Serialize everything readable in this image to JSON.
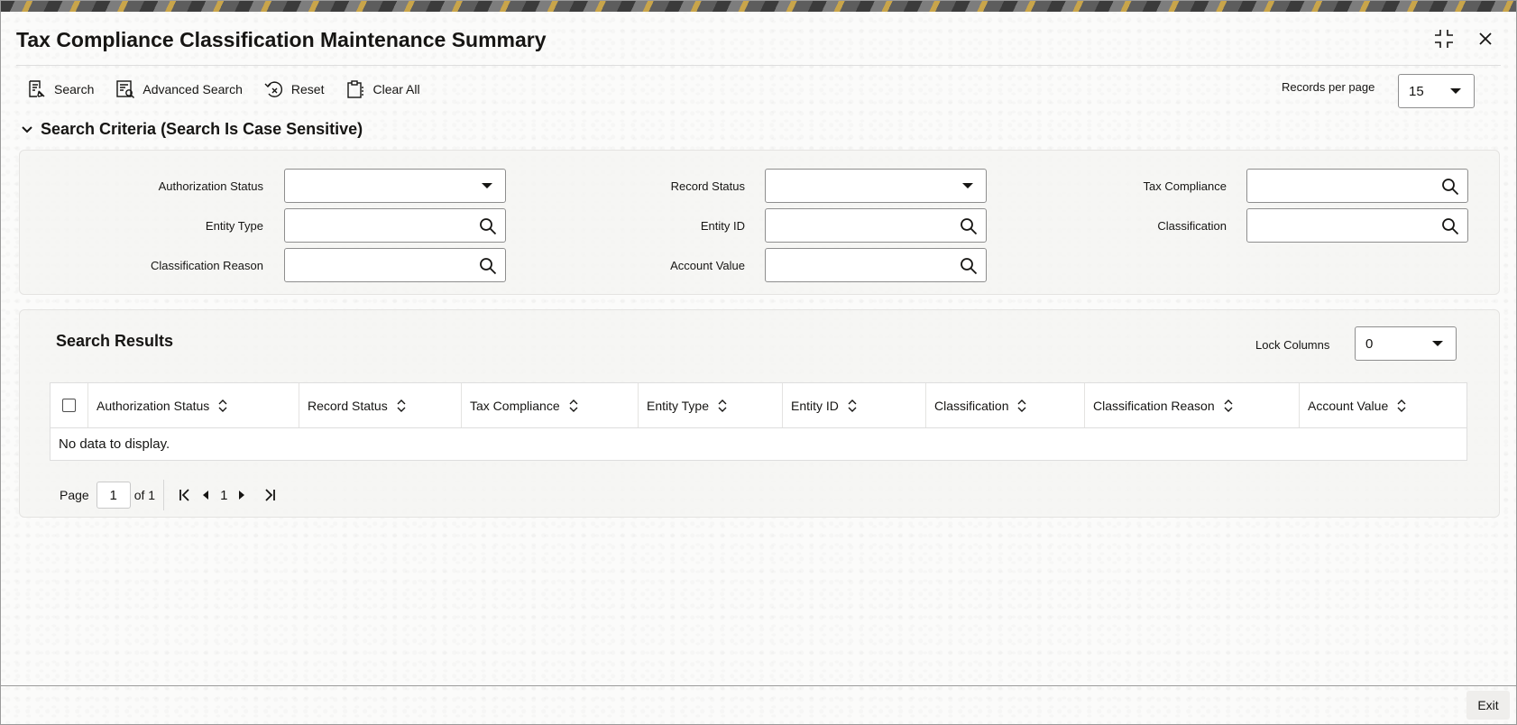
{
  "window": {
    "title": "Tax Compliance Classification Maintenance Summary"
  },
  "toolbar": {
    "search_label": "Search",
    "advanced_search_label": "Advanced Search",
    "reset_label": "Reset",
    "clear_all_label": "Clear All",
    "records_per_page_label": "Records per page",
    "records_per_page_value": "15"
  },
  "criteria": {
    "section_title": "Search Criteria (Search Is Case Sensitive)",
    "authorization_status_label": "Authorization Status",
    "authorization_status_value": "",
    "record_status_label": "Record Status",
    "record_status_value": "",
    "tax_compliance_label": "Tax Compliance",
    "entity_type_label": "Entity Type",
    "entity_id_label": "Entity ID",
    "classification_label": "Classification",
    "classification_reason_label": "Classification Reason",
    "account_value_label": "Account Value"
  },
  "results": {
    "title": "Search Results",
    "lock_columns_label": "Lock Columns",
    "lock_columns_value": "0",
    "columns": [
      "Authorization Status",
      "Record Status",
      "Tax Compliance",
      "Entity Type",
      "Entity ID",
      "Classification",
      "Classification Reason",
      "Account Value"
    ],
    "empty_message": "No data to display.",
    "pager": {
      "page_label": "Page",
      "page_value": "1",
      "of_label": "of 1",
      "current_page": "1"
    }
  },
  "footer": {
    "exit_label": "Exit"
  },
  "icons": {
    "maximize": "maximize-icon",
    "close": "close-icon",
    "search": "search-icon",
    "chevron": "chevron-down-icon"
  }
}
